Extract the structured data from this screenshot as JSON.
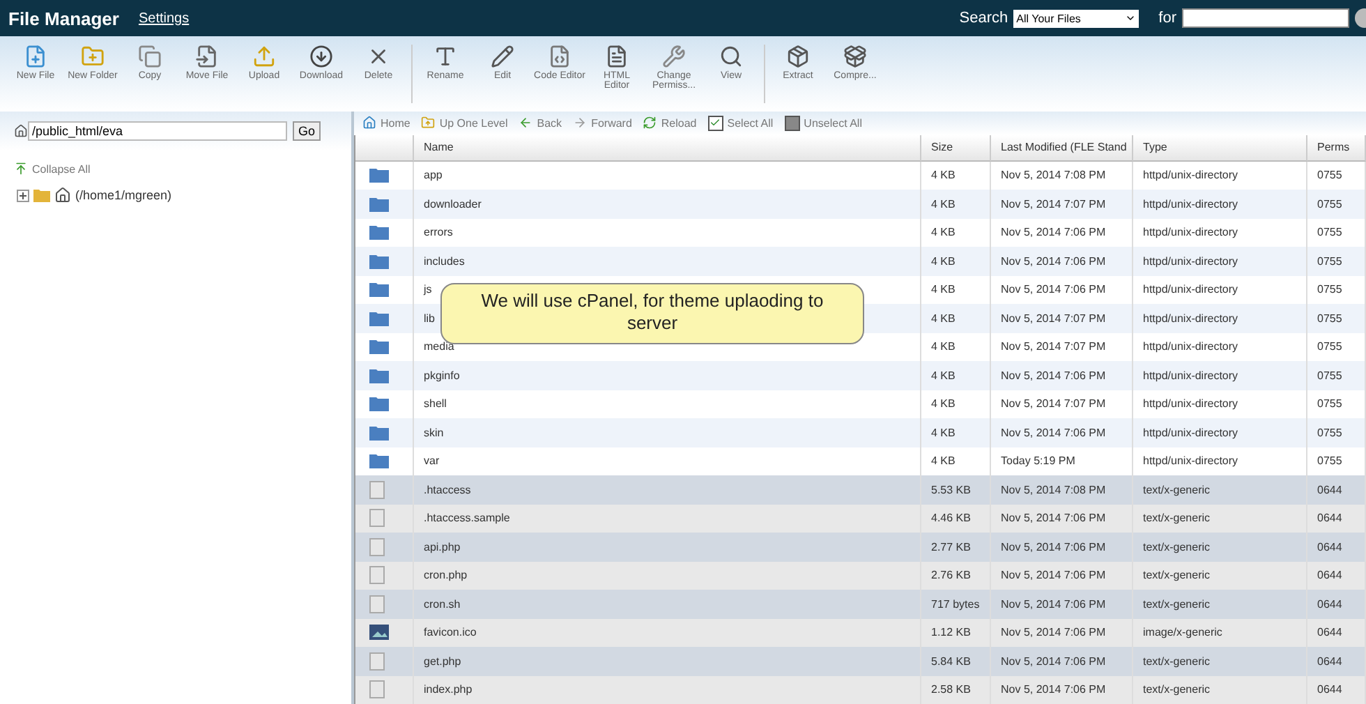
{
  "header": {
    "title": "File Manager",
    "settings_link": "Settings",
    "search_label": "Search",
    "search_scope": "All Your Files",
    "for_label": "for"
  },
  "toolbar": {
    "groups": [
      [
        "New File",
        "New Folder",
        "Copy",
        "Move File",
        "Upload",
        "Download",
        "Delete"
      ],
      [
        "Rename",
        "Edit",
        "Code Editor",
        "HTML Editor",
        "Change Permiss...",
        "View"
      ],
      [
        "Extract",
        "Compre..."
      ]
    ]
  },
  "path_bar": {
    "value": "/public_html/eva",
    "button": "Go"
  },
  "tree": {
    "collapse_all": "Collapse All",
    "items": [
      {
        "label": "(/home1/mgreen)",
        "expanded": false
      }
    ]
  },
  "nav": [
    {
      "label": "Home"
    },
    {
      "label": "Up One Level"
    },
    {
      "label": "Back"
    },
    {
      "label": "Forward"
    },
    {
      "label": "Reload"
    },
    {
      "label": "Select All",
      "checked": true
    },
    {
      "label": "Unselect All",
      "checked": false
    }
  ],
  "table": {
    "columns": [
      "Name",
      "Size",
      "Last Modified (FLE Stand",
      "Type",
      "Perms"
    ],
    "rows": [
      {
        "kind": "folder",
        "name": "app",
        "size": "4 KB",
        "modified": "Nov 5, 2014 7:08 PM",
        "type": "httpd/unix-directory",
        "perms": "0755"
      },
      {
        "kind": "folder",
        "name": "downloader",
        "size": "4 KB",
        "modified": "Nov 5, 2014 7:07 PM",
        "type": "httpd/unix-directory",
        "perms": "0755"
      },
      {
        "kind": "folder",
        "name": "errors",
        "size": "4 KB",
        "modified": "Nov 5, 2014 7:06 PM",
        "type": "httpd/unix-directory",
        "perms": "0755"
      },
      {
        "kind": "folder",
        "name": "includes",
        "size": "4 KB",
        "modified": "Nov 5, 2014 7:06 PM",
        "type": "httpd/unix-directory",
        "perms": "0755"
      },
      {
        "kind": "folder",
        "name": "js",
        "size": "4 KB",
        "modified": "Nov 5, 2014 7:06 PM",
        "type": "httpd/unix-directory",
        "perms": "0755"
      },
      {
        "kind": "folder",
        "name": "lib",
        "size": "4 KB",
        "modified": "Nov 5, 2014 7:07 PM",
        "type": "httpd/unix-directory",
        "perms": "0755"
      },
      {
        "kind": "folder",
        "name": "media",
        "size": "4 KB",
        "modified": "Nov 5, 2014 7:07 PM",
        "type": "httpd/unix-directory",
        "perms": "0755"
      },
      {
        "kind": "folder",
        "name": "pkginfo",
        "size": "4 KB",
        "modified": "Nov 5, 2014 7:06 PM",
        "type": "httpd/unix-directory",
        "perms": "0755"
      },
      {
        "kind": "folder",
        "name": "shell",
        "size": "4 KB",
        "modified": "Nov 5, 2014 7:07 PM",
        "type": "httpd/unix-directory",
        "perms": "0755"
      },
      {
        "kind": "folder",
        "name": "skin",
        "size": "4 KB",
        "modified": "Nov 5, 2014 7:06 PM",
        "type": "httpd/unix-directory",
        "perms": "0755"
      },
      {
        "kind": "folder",
        "name": "var",
        "size": "4 KB",
        "modified": "Today 5:19 PM",
        "type": "httpd/unix-directory",
        "perms": "0755"
      },
      {
        "kind": "file",
        "name": ".htaccess",
        "size": "5.53 KB",
        "modified": "Nov 5, 2014 7:08 PM",
        "type": "text/x-generic",
        "perms": "0644"
      },
      {
        "kind": "file",
        "name": ".htaccess.sample",
        "size": "4.46 KB",
        "modified": "Nov 5, 2014 7:06 PM",
        "type": "text/x-generic",
        "perms": "0644"
      },
      {
        "kind": "file",
        "name": "api.php",
        "size": "2.77 KB",
        "modified": "Nov 5, 2014 7:06 PM",
        "type": "text/x-generic",
        "perms": "0644"
      },
      {
        "kind": "file",
        "name": "cron.php",
        "size": "2.76 KB",
        "modified": "Nov 5, 2014 7:06 PM",
        "type": "text/x-generic",
        "perms": "0644"
      },
      {
        "kind": "file",
        "name": "cron.sh",
        "size": "717 bytes",
        "modified": "Nov 5, 2014 7:06 PM",
        "type": "text/x-generic",
        "perms": "0644"
      },
      {
        "kind": "image",
        "name": "favicon.ico",
        "size": "1.12 KB",
        "modified": "Nov 5, 2014 7:06 PM",
        "type": "image/x-generic",
        "perms": "0644"
      },
      {
        "kind": "file",
        "name": "get.php",
        "size": "5.84 KB",
        "modified": "Nov 5, 2014 7:06 PM",
        "type": "text/x-generic",
        "perms": "0644"
      },
      {
        "kind": "file",
        "name": "index.php",
        "size": "2.58 KB",
        "modified": "Nov 5, 2014 7:06 PM",
        "type": "text/x-generic",
        "perms": "0644"
      }
    ]
  },
  "callout": {
    "text": "We will use cPanel, for theme uplaoding to server"
  }
}
